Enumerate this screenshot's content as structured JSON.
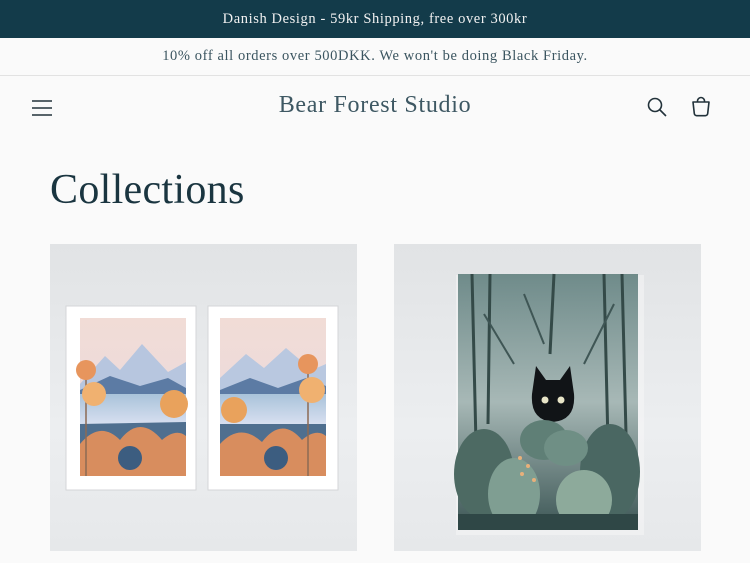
{
  "announcements": {
    "top": "Danish Design - 59kr Shipping, free over 300kr",
    "sub": "10% off all orders over 500DKK. We won't be doing Black Friday."
  },
  "header": {
    "brand": "Bear Forest Studio",
    "icons": [
      "menu-icon",
      "search-icon",
      "cart-icon"
    ]
  },
  "page": {
    "title": "Collections"
  },
  "collections": [
    {
      "image": "two-landscape-prints-lake-mountains"
    },
    {
      "image": "black-cat-in-forest-print"
    }
  ],
  "colors": {
    "announcement_bg": "#133b4a",
    "text": "#1a3540",
    "background": "#fafafa"
  }
}
